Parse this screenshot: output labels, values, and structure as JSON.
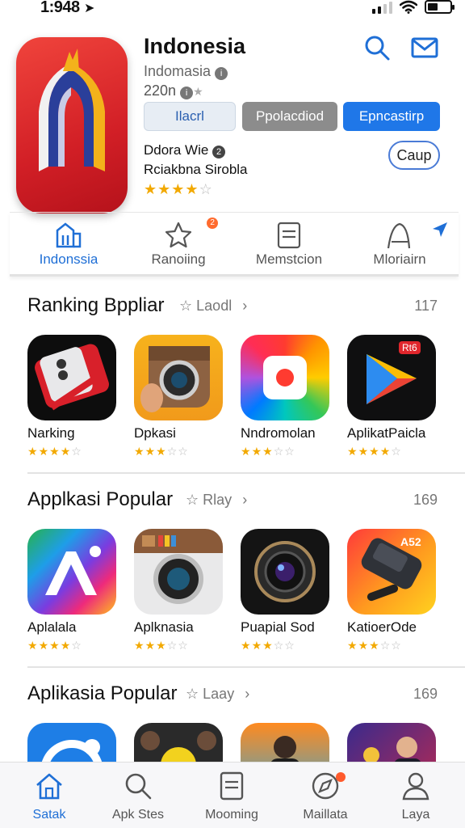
{
  "status_bar": {
    "time": "1:948",
    "location_icon": "location-arrow-icon",
    "signal_icon": "cellular-signal-icon",
    "wifi_icon": "wifi-icon",
    "battery_icon": "battery-icon"
  },
  "header": {
    "title": "Indonesia",
    "subtitle": "Indomasia",
    "meta": "220n",
    "segments": [
      "Ilacrl",
      "Ppolacdiod",
      "Epncastirp"
    ],
    "developer": "Ddora Wie",
    "developer_line2": "Rciakbna Sirobla",
    "rating": 3.5,
    "get_label": "Caup",
    "search_icon": "search-icon",
    "mail_icon": "mail-icon"
  },
  "tabs": [
    {
      "label": "Indonssia",
      "icon": "building-icon",
      "active": true
    },
    {
      "label": "Ranoiing",
      "icon": "star-icon",
      "badge": "2"
    },
    {
      "label": "Memstcion",
      "icon": "document-icon"
    },
    {
      "label": "Mloriairn",
      "icon": "send-icon"
    }
  ],
  "sections": [
    {
      "title": "Ranking Bppliar",
      "tag": "Laodl",
      "count": "117",
      "apps": [
        {
          "name": "Narking",
          "rating": 3.5
        },
        {
          "name": "Dpkasi",
          "rating": 3
        },
        {
          "name": "Nndromolan",
          "rating": 3
        },
        {
          "name": "AplikatPaicla",
          "rating": 3.5,
          "corner_label": "Rt6"
        }
      ]
    },
    {
      "title": "Applkasi Popular",
      "tag": "Rlay",
      "count": "169",
      "apps": [
        {
          "name": "Aplalala",
          "rating": 3.5
        },
        {
          "name": "Aplknasia",
          "rating": 3
        },
        {
          "name": "Puapial Sod",
          "rating": 3
        },
        {
          "name": "KatioerOde",
          "rating": 3,
          "corner_label": "A52"
        }
      ]
    },
    {
      "title": "Aplikasia Popular",
      "tag": "Laay",
      "count": "169",
      "apps": [
        {
          "name": "",
          "rating": 0
        },
        {
          "name": "",
          "rating": 0
        },
        {
          "name": "",
          "rating": 0
        },
        {
          "name": "",
          "rating": 0
        }
      ]
    }
  ],
  "bottom_nav": [
    {
      "label": "Satak",
      "icon": "home-icon",
      "active": true
    },
    {
      "label": "Apk Stes",
      "icon": "search-icon"
    },
    {
      "label": "Mooming",
      "icon": "document-icon"
    },
    {
      "label": "Maillata",
      "icon": "explore-icon",
      "badge": true
    },
    {
      "label": "Laya",
      "icon": "person-icon"
    }
  ],
  "colors": {
    "accent": "#1f77e8",
    "star": "#f2a900",
    "badge": "#ff6b2e"
  }
}
